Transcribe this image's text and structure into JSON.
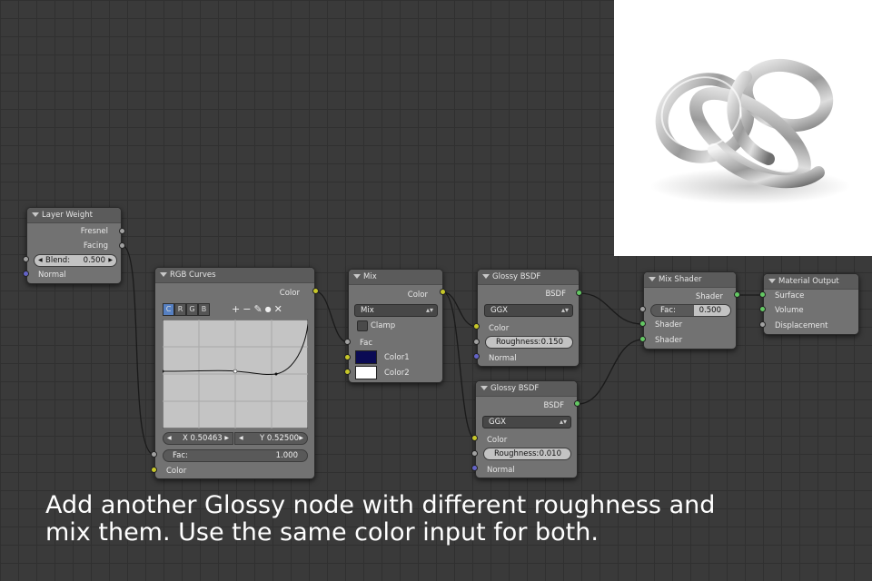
{
  "nodes": {
    "layer_weight": {
      "title": "Layer Weight",
      "outputs": [
        "Fresnel",
        "Facing"
      ],
      "blend_label": "Blend:",
      "blend_value": "0.500",
      "normal_label": "Normal"
    },
    "rgb_curves": {
      "title": "RGB Curves",
      "output": "Color",
      "tabs": [
        "C",
        "R",
        "G",
        "B"
      ],
      "tools": [
        "+",
        "−",
        "✎",
        "●",
        "✕"
      ],
      "x_field": "X 0.50463",
      "y_field": "Y 0.52500",
      "fac_label": "Fac:",
      "fac_value": "1.000",
      "color_label": "Color"
    },
    "mix": {
      "title": "Mix",
      "output": "Color",
      "blend_mode": "Mix",
      "clamp_label": "Clamp",
      "fac_label": "Fac",
      "color1_label": "Color1",
      "color2_label": "Color2",
      "color1_hex": "#0b0b54",
      "color2_hex": "#ffffff"
    },
    "glossy1": {
      "title": "Glossy BSDF",
      "output": "BSDF",
      "distribution": "GGX",
      "color_label": "Color",
      "roughness_label": "Roughness:",
      "roughness_value": "0.150",
      "normal_label": "Normal"
    },
    "glossy2": {
      "title": "Glossy BSDF",
      "output": "BSDF",
      "distribution": "GGX",
      "color_label": "Color",
      "roughness_label": "Roughness:",
      "roughness_value": "0.010",
      "normal_label": "Normal"
    },
    "mix_shader": {
      "title": "Mix Shader",
      "output": "Shader",
      "fac_label": "Fac:",
      "fac_value": "0.500",
      "shader1_label": "Shader",
      "shader2_label": "Shader"
    },
    "material_output": {
      "title": "Material Output",
      "inputs": [
        "Surface",
        "Volume",
        "Displacement"
      ]
    }
  },
  "caption": {
    "line1": "Add another Glossy node with different roughness and",
    "line2": "mix them. Use the same color input for both."
  },
  "colors": {
    "socket_gray": "#a1a1a1",
    "socket_yellow": "#c7c729",
    "socket_blue": "#6363c7",
    "socket_green": "#63c763",
    "node_body": "#727272",
    "node_header": "#5b5b5b",
    "background": "#3a3a3a"
  }
}
